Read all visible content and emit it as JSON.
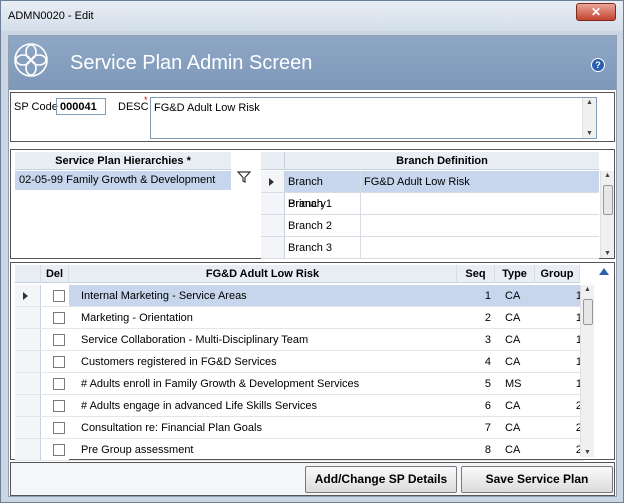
{
  "window": {
    "title": "ADMN0020 - Edit",
    "close_glyph": "✕"
  },
  "header": {
    "title": "Service Plan Admin Screen",
    "help_glyph": "?"
  },
  "sp": {
    "code_label": "SP Code",
    "code_value": "000041",
    "desc_label": "DESC",
    "desc_required": "*",
    "desc_value": "FG&D Adult Low Risk"
  },
  "hierarchies": {
    "header": "Service Plan Hierarchies",
    "required": "*",
    "rows": [
      {
        "code": "02-05-99",
        "name": "Family Growth & Development"
      }
    ]
  },
  "branch_definition": {
    "header": "Branch Definition",
    "rows": [
      {
        "label": "Branch Primary",
        "value": "FG&D Adult Low Risk",
        "selected": true
      },
      {
        "label": "Branch 1",
        "value": "",
        "selected": false
      },
      {
        "label": "Branch 2",
        "value": "",
        "selected": false
      },
      {
        "label": "Branch 3",
        "value": "",
        "selected": false
      }
    ]
  },
  "items_grid": {
    "columns": {
      "del": "Del",
      "name": "FG&D Adult Low Risk",
      "seq": "Seq",
      "type": "Type",
      "group": "Group"
    },
    "rows": [
      {
        "name": "Internal Marketing - Service Areas",
        "seq": "1",
        "type": "CA",
        "group": "1",
        "selected": true
      },
      {
        "name": "Marketing - Orientation",
        "seq": "2",
        "type": "CA",
        "group": "1",
        "selected": false
      },
      {
        "name": "Service Collaboration - Multi-Disciplinary Team",
        "seq": "3",
        "type": "CA",
        "group": "1",
        "selected": false
      },
      {
        "name": "Customers registered in FG&D Services",
        "seq": "4",
        "type": "CA",
        "group": "1",
        "selected": false
      },
      {
        "name": "# Adults enroll in Family Growth & Development Services",
        "seq": "5",
        "type": "MS",
        "group": "1",
        "selected": false
      },
      {
        "name": "# Adults engage in advanced Life Skills Services",
        "seq": "6",
        "type": "CA",
        "group": "2",
        "selected": false
      },
      {
        "name": "Consultation re: Financial Plan Goals",
        "seq": "7",
        "type": "CA",
        "group": "2",
        "selected": false
      },
      {
        "name": "Pre Group assessment",
        "seq": "8",
        "type": "CA",
        "group": "2",
        "selected": false
      }
    ]
  },
  "footer": {
    "add_change_label": "Add/Change SP Details",
    "save_label": "Save Service Plan"
  }
}
